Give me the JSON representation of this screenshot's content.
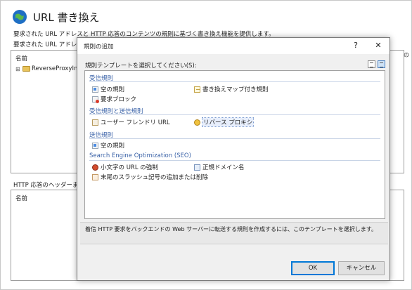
{
  "background": {
    "title": "URL 書き換え",
    "description_line1": "要求された URL アドレスと HTTP 応答のコンテンツの規則に基づく書き換え機能を提供します。",
    "description_line2": "要求された URL アドレスに",
    "list_column": "名前",
    "list_item": "ReverseProxyInbo",
    "http_section": "HTTP 応答のヘッダーまたは",
    "list2_column": "名前",
    "right_fragment": "の"
  },
  "dialog": {
    "title": "規則の追加",
    "help": "?",
    "close": "✕",
    "prompt": "規則テンプレートを選択してください(S):",
    "groups": {
      "inbound": "受信規則",
      "inbound_outbound": "受信規則と送信規則",
      "outbound": "送信規則",
      "seo": "Search Engine Optimization (SEO)"
    },
    "templates": {
      "blank_rule": "空の規則",
      "rewrite_map_rule": "書き換えマップ付き規則",
      "request_blocking": "要求ブロック",
      "user_friendly_url": "ユーザー フレンドリ URL",
      "reverse_proxy": "リバース プロキシ",
      "outbound_blank_rule": "空の規則",
      "lowercase_url": "小文字の URL の強制",
      "canonical_domain": "正規ドメイン名",
      "trailing_slash": "末尾のスラッシュ記号の追加または削除"
    },
    "description": "着信 HTTP 要求をバックエンドの Web サーバーに転送する規則を作成するには、このテンプレートを選択します。",
    "ok": "OK",
    "cancel": "キャンセル"
  },
  "colors": {
    "group_header": "#3b63a8",
    "accent": "#0078d7"
  }
}
